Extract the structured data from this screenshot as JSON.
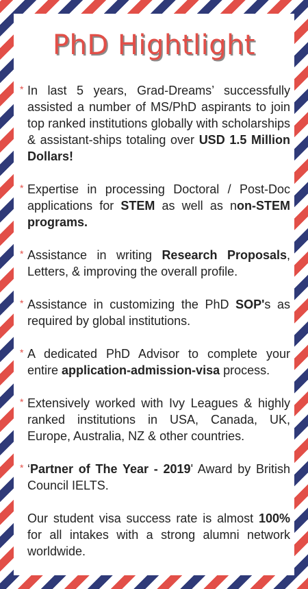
{
  "title": "PhD Hightlight",
  "bullets": [
    {
      "p1": "In last 5 years, Grad-Dreams’ successfully assisted a number of MS/PhD aspirants to join top ranked institutions globally with scholarships & assistant-ships totaling over ",
      "b1": "USD 1.5 Million Dollars!"
    },
    {
      "p1": "Expertise in processing Doctoral / Post-Doc applications for ",
      "b1": "STEM",
      "p2": " as well as n",
      "b2": "on-STEM programs."
    },
    {
      "p1": "Assistance in writing ",
      "b1": "Research Proposals",
      "p2": ", Letters, & improving the overall profile."
    },
    {
      "p1": "Assistance in customizing the PhD ",
      "b1": "SOP'",
      "p2": "s as required by global institutions."
    },
    {
      "p1": "A dedicated PhD Advisor to complete your entire ",
      "b1": "application-admission-visa",
      "p2": " process."
    },
    {
      "p1": "Extensively worked with Ivy Leagues & highly ranked institutions in USA, Canada, UK, Europe, Australia, NZ & other countries."
    },
    {
      "p1": "‘",
      "b1": "Partner of The Year - 2019",
      "p2": "' Award by British Council IELTS."
    }
  ],
  "closing": {
    "p1": "Our student visa success rate is almost ",
    "b1": "100%",
    "p2": " for all intakes with a strong alumni network worldwide."
  },
  "colors": {
    "red": "#e24f48",
    "navy": "#2f3a78",
    "text": "#222222"
  }
}
